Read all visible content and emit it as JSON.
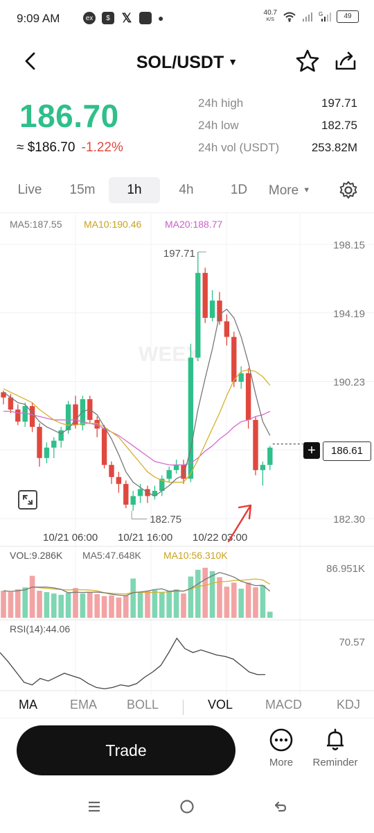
{
  "status_bar": {
    "time": "9:09 AM",
    "net_speed": "40.7",
    "net_unit": "K/S",
    "battery": "49"
  },
  "header": {
    "title": "SOL/USDT"
  },
  "price": {
    "last": "186.70",
    "fiat": "≈ $186.70",
    "change": "-1.22%"
  },
  "stats": [
    {
      "label": "24h high",
      "value": "197.71"
    },
    {
      "label": "24h low",
      "value": "182.75"
    },
    {
      "label": "24h vol (USDT)",
      "value": "253.82M"
    }
  ],
  "time_tabs": [
    {
      "label": "Live",
      "active": false
    },
    {
      "label": "15m",
      "active": false
    },
    {
      "label": "1h",
      "active": true
    },
    {
      "label": "4h",
      "active": false
    },
    {
      "label": "1D",
      "active": false
    },
    {
      "label": "More",
      "active": false
    }
  ],
  "ma_labels": {
    "ma5": "MA5:187.55",
    "ma10": "MA10:190.46",
    "ma20": "MA20:188.77"
  },
  "colors": {
    "up": "#2fbf8a",
    "down": "#e0483e",
    "ma5": "#777777",
    "ma10": "#d4b12b",
    "ma20": "#d36bd1",
    "vol_up": "#7fd6b2",
    "vol_down": "#f2a3a3"
  },
  "chart_data": {
    "type": "candlestick",
    "title": "",
    "price_axis": [
      "198.15",
      "194.19",
      "190.23",
      "186.27",
      "182.30"
    ],
    "ylim": [
      182.3,
      198.15
    ],
    "time_axis": [
      "10/21 06:00",
      "10/21 16:00",
      "10/22 03:00"
    ],
    "high_label": "197.71",
    "low_label": "182.75",
    "last_price": "186.61",
    "candles": [
      [
        189.6,
        189.3,
        189.7,
        188.9
      ],
      [
        189.3,
        188.6,
        189.5,
        188.4
      ],
      [
        188.6,
        187.9,
        188.9,
        187.7
      ],
      [
        187.9,
        188.8,
        189.0,
        187.6
      ],
      [
        188.8,
        187.6,
        189.0,
        187.3
      ],
      [
        187.6,
        185.8,
        187.8,
        185.3
      ],
      [
        185.8,
        186.4,
        186.7,
        185.5
      ],
      [
        186.4,
        186.8,
        187.0,
        185.8
      ],
      [
        186.8,
        187.4,
        187.6,
        186.4
      ],
      [
        187.4,
        188.9,
        189.1,
        187.2
      ],
      [
        188.9,
        187.7,
        189.4,
        187.5
      ],
      [
        187.7,
        189.2,
        189.4,
        187.4
      ],
      [
        189.2,
        188.0,
        189.4,
        187.8
      ],
      [
        188.0,
        187.5,
        188.2,
        187.0
      ],
      [
        187.5,
        185.4,
        187.7,
        185.2
      ],
      [
        185.4,
        184.7,
        185.6,
        184.3
      ],
      [
        184.7,
        184.3,
        185.0,
        183.8
      ],
      [
        184.3,
        183.1,
        184.5,
        182.9
      ],
      [
        183.1,
        183.6,
        183.9,
        182.75
      ],
      [
        183.6,
        184.0,
        184.3,
        183.2
      ],
      [
        184.0,
        183.6,
        184.2,
        183.2
      ],
      [
        183.6,
        183.9,
        184.2,
        183.4
      ],
      [
        183.9,
        184.6,
        184.8,
        183.6
      ],
      [
        184.6,
        185.1,
        185.3,
        184.4
      ],
      [
        185.1,
        185.4,
        185.7,
        184.9
      ],
      [
        185.4,
        184.6,
        185.7,
        184.3
      ],
      [
        184.6,
        191.6,
        192.4,
        184.4
      ],
      [
        191.6,
        196.5,
        197.71,
        191.4
      ],
      [
        196.5,
        193.9,
        196.8,
        193.6
      ],
      [
        193.9,
        194.9,
        195.5,
        193.7
      ],
      [
        194.9,
        193.7,
        195.4,
        193.5
      ],
      [
        193.7,
        192.8,
        194.1,
        192.3
      ],
      [
        192.8,
        190.2,
        193.1,
        189.9
      ],
      [
        190.2,
        190.7,
        191.1,
        189.8
      ],
      [
        190.7,
        188.0,
        191.0,
        187.5
      ],
      [
        188.0,
        185.1,
        188.2,
        184.8
      ],
      [
        185.1,
        185.4,
        185.6,
        184.2
      ],
      [
        185.4,
        186.4,
        186.5,
        185.1
      ]
    ],
    "ma5": [
      189.6,
      189.3,
      189.0,
      188.9,
      188.4,
      187.9,
      187.6,
      187.4,
      187.2,
      187.5,
      188.0,
      188.5,
      188.6,
      188.3,
      187.6,
      186.9,
      186.0,
      185.0,
      184.4,
      184.1,
      183.8,
      183.6,
      183.9,
      184.2,
      184.6,
      184.8,
      186.3,
      188.6,
      190.4,
      192.1,
      194.1,
      194.4,
      193.9,
      192.8,
      191.3,
      189.5,
      187.9,
      187.1
    ],
    "ma10": [
      189.8,
      189.6,
      189.4,
      189.2,
      189.0,
      188.6,
      188.3,
      188.0,
      187.8,
      187.7,
      187.7,
      187.8,
      187.8,
      187.8,
      187.6,
      187.3,
      187.0,
      186.5,
      186.0,
      185.5,
      185.0,
      184.7,
      184.5,
      184.4,
      184.4,
      184.4,
      184.9,
      185.7,
      186.6,
      187.5,
      188.4,
      189.4,
      190.3,
      190.8,
      190.9,
      190.8,
      190.5,
      190.0
    ],
    "ma20": [
      188.5,
      188.5,
      188.4,
      188.4,
      188.3,
      188.2,
      188.1,
      188.0,
      188.0,
      188.0,
      188.0,
      187.9,
      187.8,
      187.7,
      187.5,
      187.3,
      187.1,
      186.8,
      186.5,
      186.2,
      185.9,
      185.6,
      185.5,
      185.4,
      185.4,
      185.4,
      185.5,
      185.8,
      186.2,
      186.5,
      186.9,
      187.2,
      187.6,
      187.9,
      188.0,
      188.2,
      188.3,
      188.5
    ]
  },
  "volume": {
    "labels": {
      "vol": "VOL:9.286K",
      "ma5": "MA5:47.648K",
      "ma10": "MA10:56.310K"
    },
    "axis_max": "86.951K",
    "bars": [
      40,
      38,
      42,
      45,
      62,
      40,
      38,
      36,
      34,
      37,
      44,
      36,
      38,
      35,
      32,
      33,
      30,
      33,
      58,
      37,
      40,
      41,
      38,
      40,
      42,
      36,
      61,
      71,
      74,
      69,
      60,
      46,
      52,
      43,
      52,
      45,
      48,
      9
    ]
  },
  "rsi": {
    "label": "RSI(14):44.06",
    "axis_max": "70.57",
    "values": [
      55,
      48,
      40,
      32,
      30,
      35,
      33,
      36,
      39,
      37,
      35,
      31,
      28,
      27,
      28,
      30,
      29,
      31,
      36,
      40,
      45,
      55,
      66,
      58,
      55,
      57,
      55,
      53,
      52,
      50,
      45,
      40,
      38,
      38
    ]
  },
  "indicator_tabs": [
    "MA",
    "EMA",
    "BOLL",
    "VOL",
    "MACD",
    "KDJ"
  ],
  "bottom": {
    "trade_label": "Trade",
    "more_label": "More",
    "reminder_label": "Reminder"
  }
}
